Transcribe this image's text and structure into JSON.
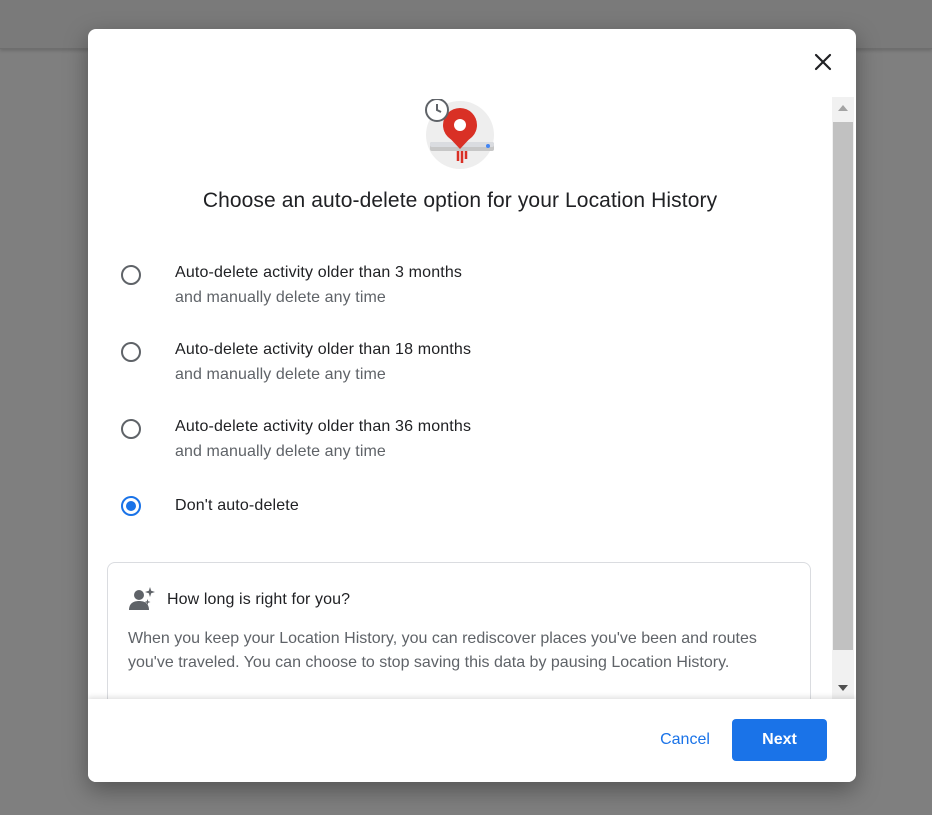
{
  "dialog": {
    "title": "Choose an auto-delete option for your Location History",
    "close_icon": "close-icon",
    "hero_icon": "location-history-timer-icon",
    "options": [
      {
        "label": "Auto-delete activity older than 3 months",
        "sublabel": "and manually delete any time",
        "checked": false
      },
      {
        "label": "Auto-delete activity older than 18 months",
        "sublabel": "and manually delete any time",
        "checked": false
      },
      {
        "label": "Auto-delete activity older than 36 months",
        "sublabel": "and manually delete any time",
        "checked": false
      },
      {
        "label": "Don't auto-delete",
        "checked": true
      }
    ],
    "info": {
      "icon": "person-sparkle-icon",
      "title": "How long is right for you?",
      "body": "When you keep your Location History, you can rediscover places you've been and routes you've traveled. You can choose to stop saving this data by pausing Location History."
    },
    "footer": {
      "cancel_label": "Cancel",
      "next_label": "Next"
    }
  },
  "colors": {
    "accent": "#1a73e8",
    "brand_red": "#d93025",
    "overlay": "#7f7f7f",
    "text_primary": "#202124",
    "text_secondary": "#5f6368"
  }
}
